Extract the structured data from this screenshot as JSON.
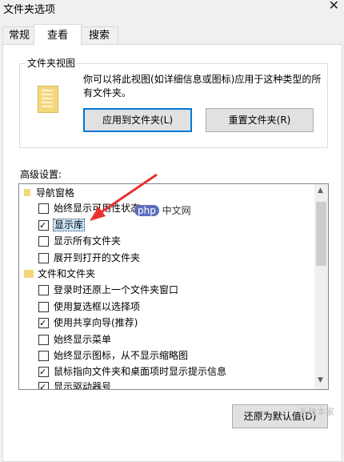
{
  "window": {
    "title": "文件夹选项"
  },
  "tabs": [
    {
      "label": "常规"
    },
    {
      "label": "查看"
    },
    {
      "label": "搜索"
    }
  ],
  "folder_views": {
    "title": "文件夹视图",
    "description": "你可以将此视图(如详细信息或图标)应用于这种类型的所有文件夹。",
    "apply_button": "应用到文件夹(L)",
    "reset_button": "重置文件夹(R)"
  },
  "advanced": {
    "label": "高级设置:",
    "items": [
      {
        "label": "导航窗格",
        "type": "folder"
      },
      {
        "label": "始终显示可用性状态",
        "type": "checkbox",
        "checked": false
      },
      {
        "label": "显示库",
        "type": "checkbox",
        "checked": true
      },
      {
        "label": "显示所有文件夹",
        "type": "checkbox",
        "checked": false
      },
      {
        "label": "展开到打开的文件夹",
        "type": "checkbox",
        "checked": false
      },
      {
        "label": "文件和文件夹",
        "type": "folder"
      },
      {
        "label": "登录时还原上一个文件夹窗口",
        "type": "checkbox",
        "checked": false
      },
      {
        "label": "使用复选框以选择项",
        "type": "checkbox",
        "checked": false
      },
      {
        "label": "使用共享向导(推荐)",
        "type": "checkbox",
        "checked": true
      },
      {
        "label": "始终显示菜单",
        "type": "checkbox",
        "checked": false
      },
      {
        "label": "始终显示图标，从不显示缩略图",
        "type": "checkbox",
        "checked": false
      },
      {
        "label": "鼠标指向文件夹和桌面项时显示提示信息",
        "type": "checkbox",
        "checked": true
      },
      {
        "label": "显示驱动器号",
        "type": "checkbox",
        "checked": true
      }
    ]
  },
  "restore_button": "还原为默认值(D)",
  "watermark": {
    "php": "php 中文网",
    "brand": "系统本家"
  },
  "colors": {
    "selection": "#cce8ff",
    "accent": "#0078d7",
    "arrow": "#e8322f"
  }
}
